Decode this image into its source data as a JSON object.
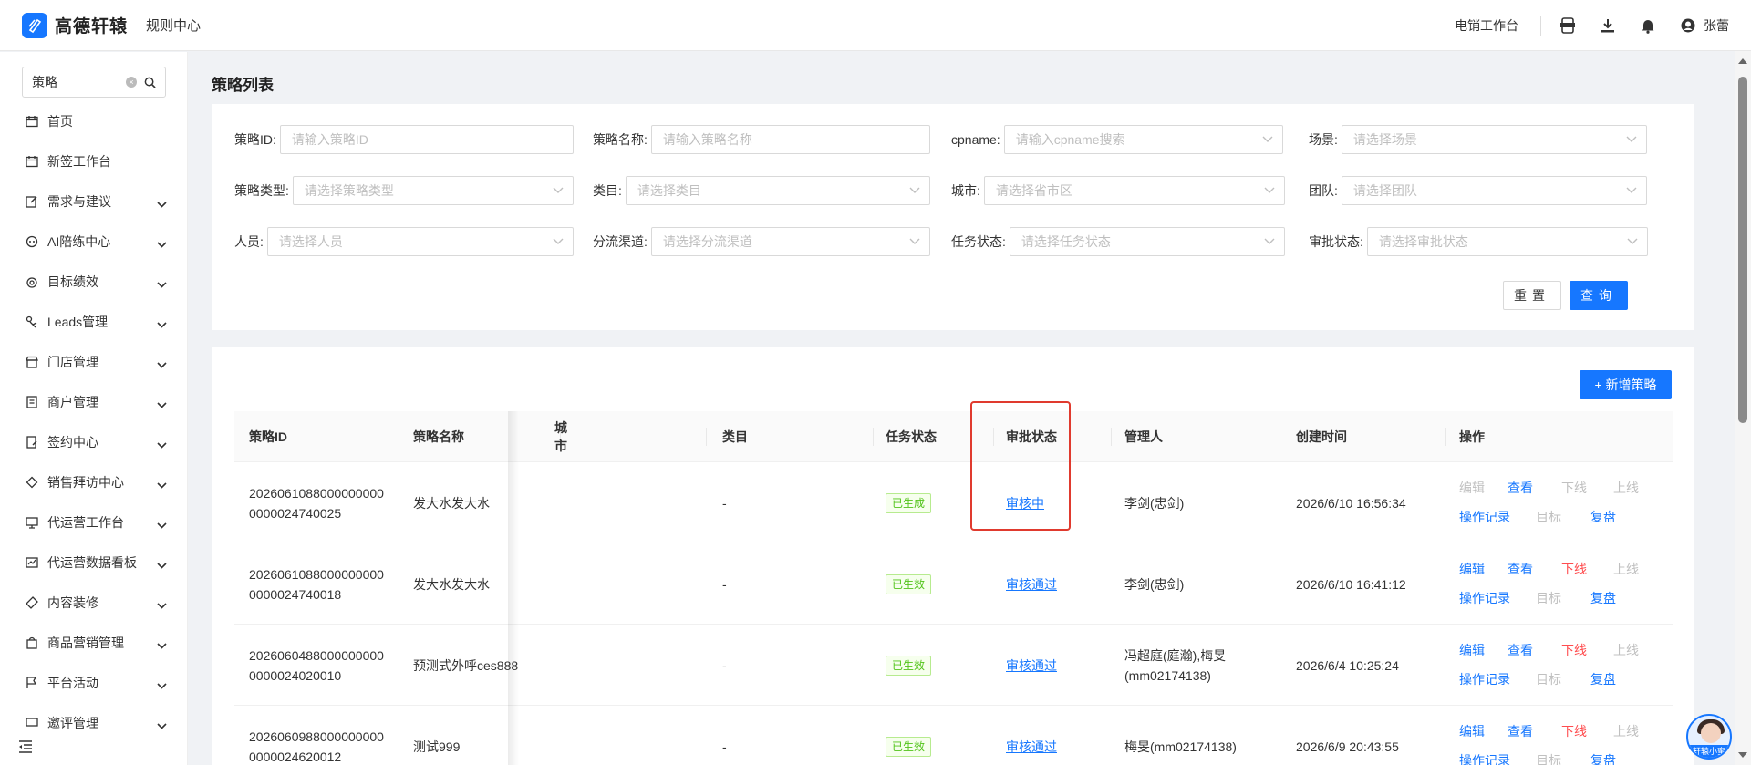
{
  "topbar": {
    "brand": "高德轩辕",
    "module": "规则中心",
    "workspace": "电销工作台",
    "user_name": "张蕾"
  },
  "sidebar": {
    "search_value": "策略",
    "items": [
      {
        "label": "首页",
        "icon": "calendar-icon",
        "expandable": false
      },
      {
        "label": "新签工作台",
        "icon": "calendar-icon",
        "expandable": false
      },
      {
        "label": "需求与建议",
        "icon": "edit-icon",
        "expandable": true
      },
      {
        "label": "AI陪练中心",
        "icon": "ai-icon",
        "expandable": true
      },
      {
        "label": "目标绩效",
        "icon": "target-icon",
        "expandable": true
      },
      {
        "label": "Leads管理",
        "icon": "leads-icon",
        "expandable": true
      },
      {
        "label": "门店管理",
        "icon": "store-icon",
        "expandable": true
      },
      {
        "label": "商户管理",
        "icon": "merchant-icon",
        "expandable": true
      },
      {
        "label": "签约中心",
        "icon": "contract-icon",
        "expandable": true
      },
      {
        "label": "销售拜访中心",
        "icon": "diamond-icon",
        "expandable": true
      },
      {
        "label": "代运营工作台",
        "icon": "monitor-icon",
        "expandable": true
      },
      {
        "label": "代运营数据看板",
        "icon": "dashboard-icon",
        "expandable": true
      },
      {
        "label": "内容装修",
        "icon": "brush-icon",
        "expandable": true
      },
      {
        "label": "商品营销管理",
        "icon": "bag-icon",
        "expandable": true
      },
      {
        "label": "平台活动",
        "icon": "flag-icon",
        "expandable": true
      },
      {
        "label": "邀评管理",
        "icon": "comment-icon",
        "expandable": true
      }
    ]
  },
  "page": {
    "title": "策略列表"
  },
  "filters": {
    "strategy_id": {
      "label": "策略ID:",
      "placeholder": "请输入策略ID"
    },
    "strategy_name": {
      "label": "策略名称:",
      "placeholder": "请输入策略名称"
    },
    "cpname": {
      "label": "cpname:",
      "placeholder": "请输入cpname搜索"
    },
    "scene": {
      "label": "场景:",
      "placeholder": "请选择场景"
    },
    "strategy_type": {
      "label": "策略类型:",
      "placeholder": "请选择策略类型"
    },
    "category": {
      "label": "类目:",
      "placeholder": "请选择类目"
    },
    "city": {
      "label": "城市:",
      "placeholder": "请选择省市区"
    },
    "team": {
      "label": "团队:",
      "placeholder": "请选择团队"
    },
    "person": {
      "label": "人员:",
      "placeholder": "请选择人员"
    },
    "channel": {
      "label": "分流渠道:",
      "placeholder": "请选择分流渠道"
    },
    "task_status": {
      "label": "任务状态:",
      "placeholder": "请选择任务状态"
    },
    "approval_status": {
      "label": "审批状态:",
      "placeholder": "请选择审批状态"
    },
    "reset_label": "重置",
    "query_label": "查询"
  },
  "table": {
    "add_label": "+ 新增策略",
    "columns": [
      "策略ID",
      "策略名称",
      "城市",
      "类目",
      "任务状态",
      "审批状态",
      "管理人",
      "创建时间",
      "操作"
    ],
    "rows": [
      {
        "id_line1": "2026061088000000000",
        "id_line2": "0000024740025",
        "name": "发大水发大水",
        "category": "-",
        "task_status": "已生成",
        "approval_status": "审核中",
        "manager_line1": "李剑(忠剑)",
        "manager_line2": "",
        "created": "2026/6/10 16:56:34",
        "ops": {
          "edit": "编辑",
          "view": "查看",
          "offline": "下线",
          "online": "上线",
          "log": "操作记录",
          "target": "目标",
          "review": "复盘"
        },
        "ops_state": {
          "edit": "disabled",
          "offline": "disabled"
        }
      },
      {
        "id_line1": "2026061088000000000",
        "id_line2": "0000024740018",
        "name": "发大水发大水",
        "category": "-",
        "task_status": "已生效",
        "approval_status": "审核通过",
        "manager_line1": "李剑(忠剑)",
        "manager_line2": "",
        "created": "2026/6/10 16:41:12",
        "ops": {
          "edit": "编辑",
          "view": "查看",
          "offline": "下线",
          "online": "上线",
          "log": "操作记录",
          "target": "目标",
          "review": "复盘"
        },
        "ops_state": {
          "edit": "enabled",
          "offline": "danger"
        }
      },
      {
        "id_line1": "2026060488000000000",
        "id_line2": "0000024020010",
        "name": "预测式外呼ces888",
        "category": "-",
        "task_status": "已生效",
        "approval_status": "审核通过",
        "manager_line1": "冯超庭(庭瀚),梅旻",
        "manager_line2": "(mm02174138)",
        "created": "2026/6/4 10:25:24",
        "ops": {
          "edit": "编辑",
          "view": "查看",
          "offline": "下线",
          "online": "上线",
          "log": "操作记录",
          "target": "目标",
          "review": "复盘"
        },
        "ops_state": {
          "edit": "enabled",
          "offline": "danger"
        }
      },
      {
        "id_line1": "2026060988000000000",
        "id_line2": "0000024620012",
        "name": "测试999",
        "category": "-",
        "task_status": "已生效",
        "approval_status": "审核通过",
        "manager_line1": "梅旻(mm02174138)",
        "manager_line2": "",
        "created": "2026/6/9 20:43:55",
        "ops": {
          "edit": "编辑",
          "view": "查看",
          "offline": "下线",
          "online": "上线",
          "log": "操作记录",
          "target": "目标",
          "review": "复盘"
        },
        "ops_state": {
          "edit": "enabled",
          "offline": "danger"
        }
      }
    ]
  },
  "assistant": {
    "label": "轩辕小蜜"
  },
  "colors": {
    "primary": "#1677ff",
    "danger": "#ff4d4f",
    "success": "#52c41a",
    "highlight_box": "#e03a2e"
  }
}
